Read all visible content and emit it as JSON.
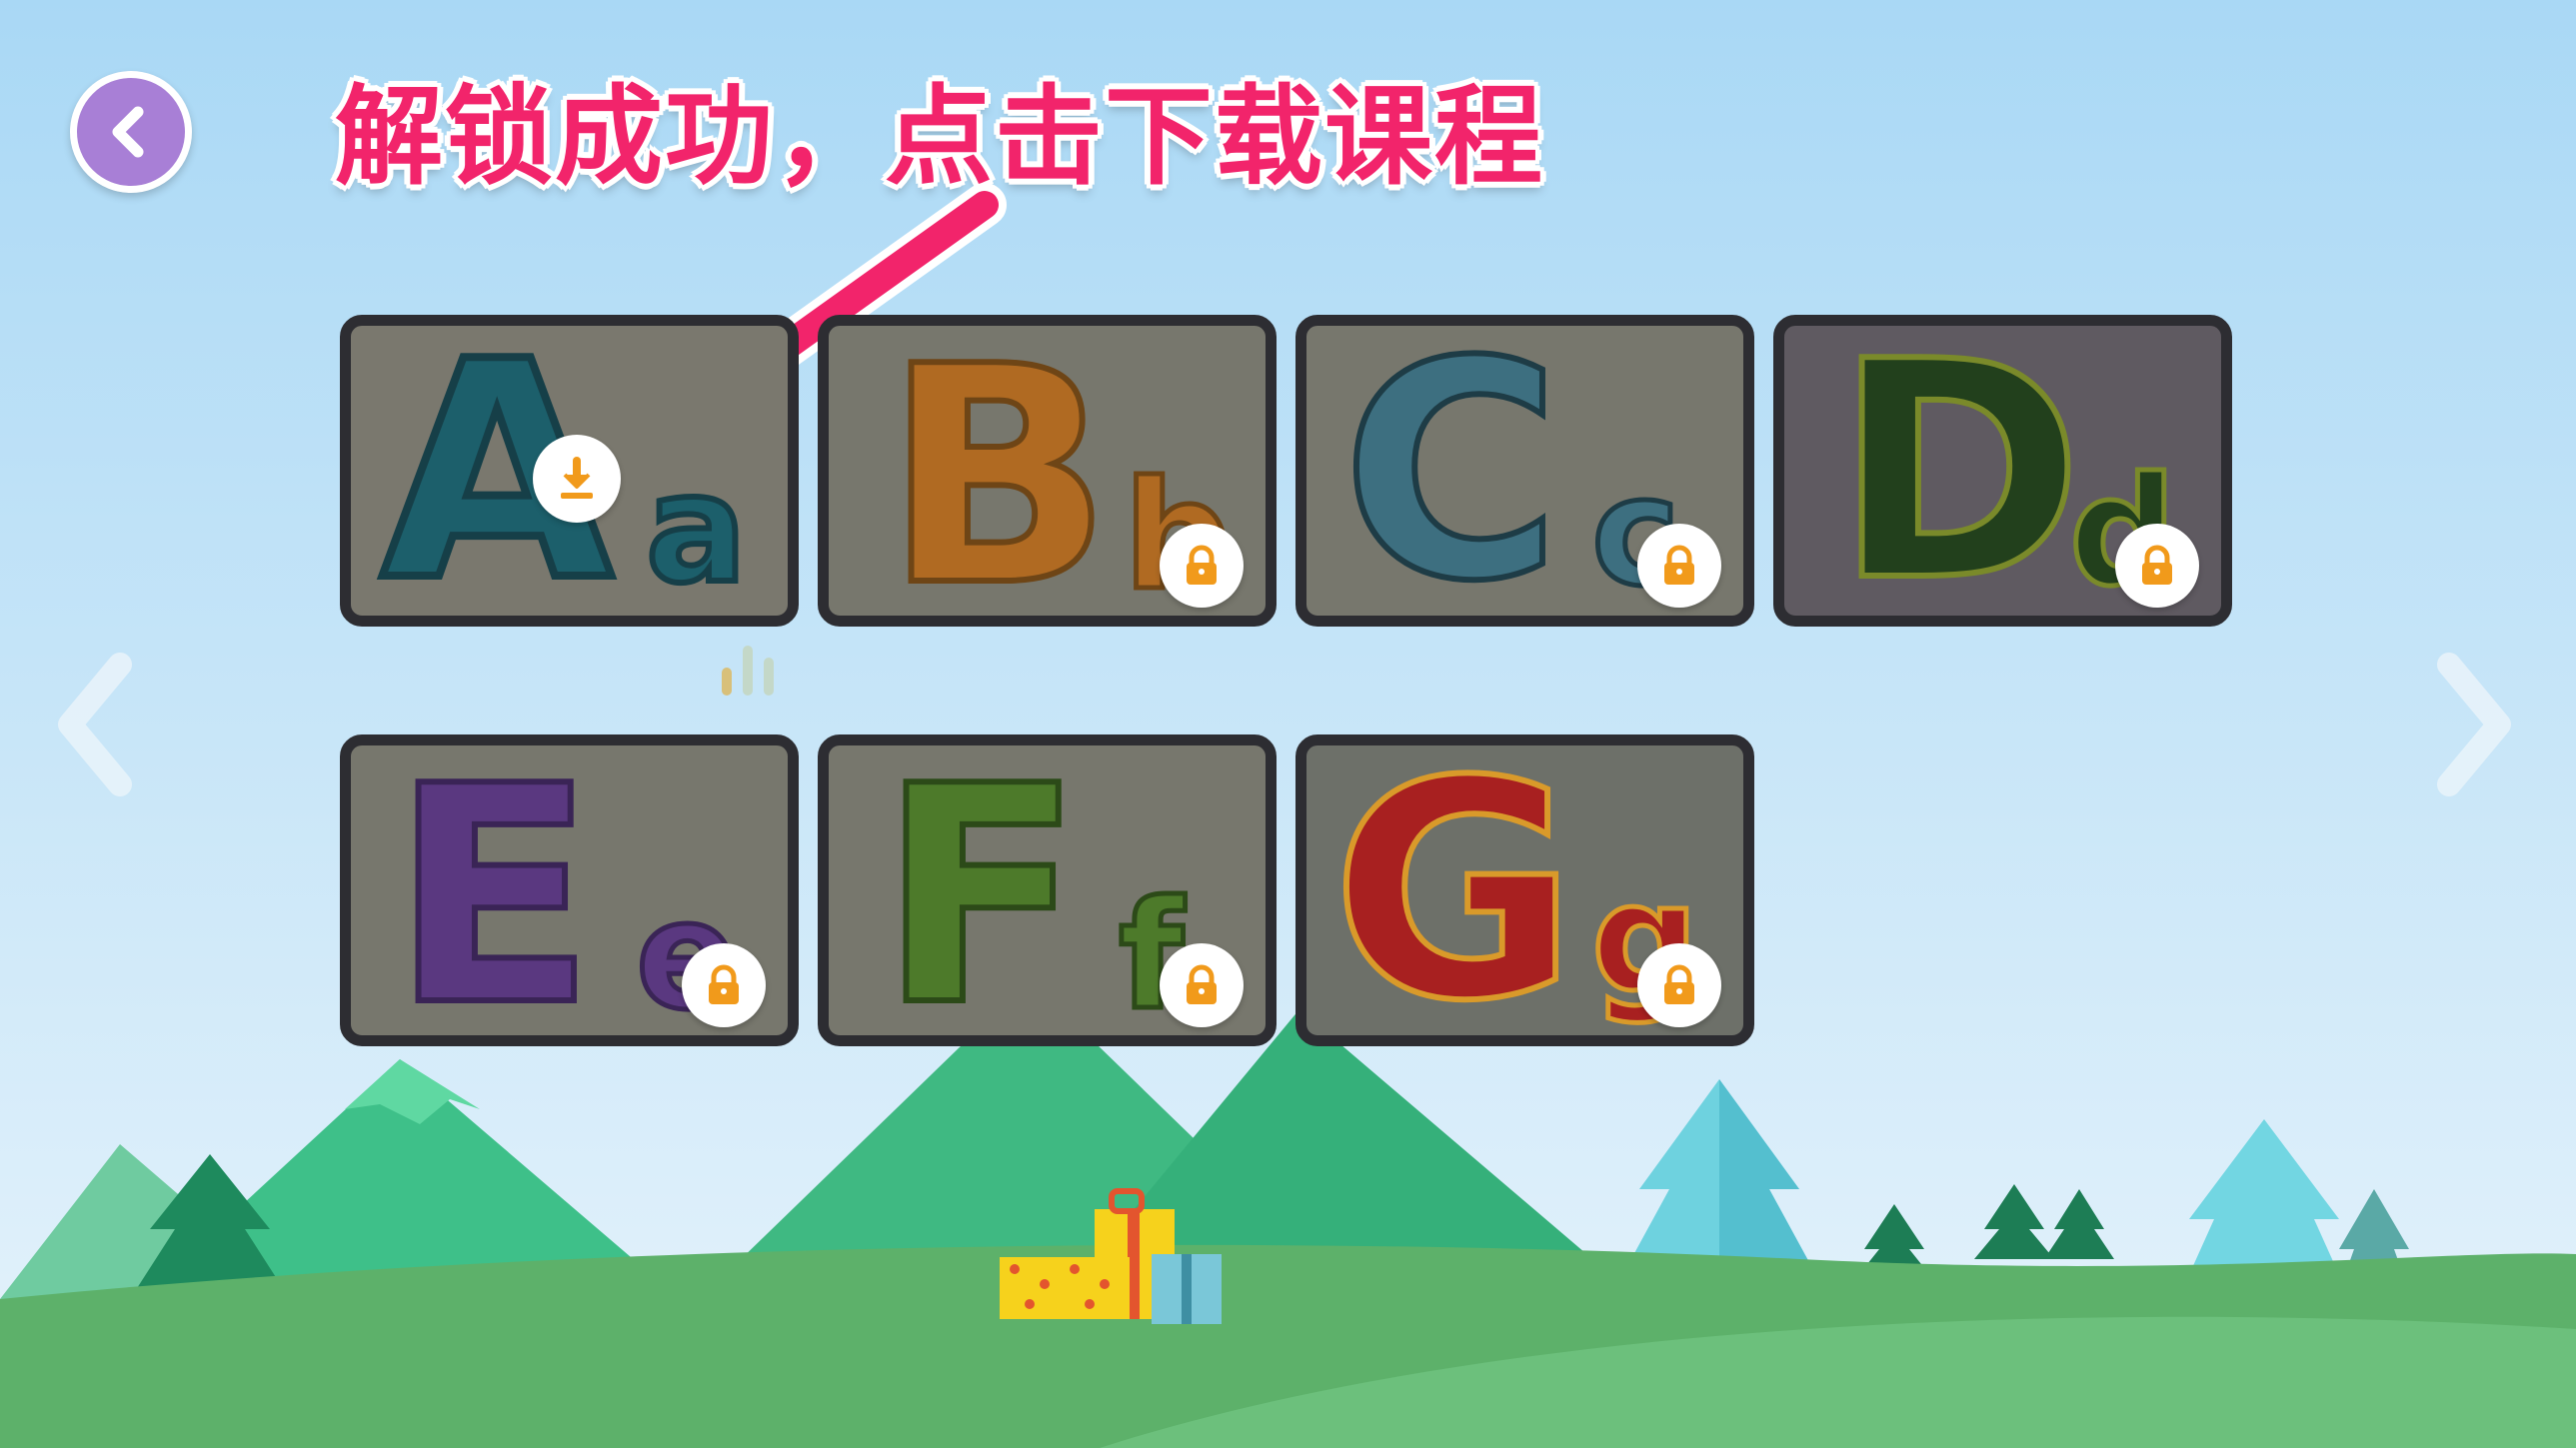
{
  "header": {
    "hint": "解锁成功，点击下载课程"
  },
  "lessons": [
    {
      "upper": "A",
      "lower": "a",
      "status": "unlocked",
      "icon": "download-icon",
      "color": "#1c5f6b"
    },
    {
      "upper": "B",
      "lower": "b",
      "status": "locked",
      "icon": "lock-icon",
      "color": "#b06a22"
    },
    {
      "upper": "C",
      "lower": "c",
      "status": "locked",
      "icon": "lock-icon",
      "color": "#3d6f80"
    },
    {
      "upper": "D",
      "lower": "d",
      "status": "locked",
      "icon": "lock-icon",
      "color": "#22401c"
    },
    {
      "upper": "E",
      "lower": "e",
      "status": "locked",
      "icon": "lock-icon",
      "color": "#5a3880"
    },
    {
      "upper": "F",
      "lower": "f",
      "status": "locked",
      "icon": "lock-icon",
      "color": "#4d7a2a"
    },
    {
      "upper": "G",
      "lower": "g",
      "status": "locked",
      "icon": "lock-icon",
      "color": "#a82020"
    }
  ],
  "colors": {
    "sky_top": "#a9d8f5",
    "sky_bottom": "#e6f3fb",
    "accent": "#f2246b",
    "back_button": "#a87fd6",
    "badge_icon": "#f19a1b",
    "card_border": "#2d2d32"
  }
}
